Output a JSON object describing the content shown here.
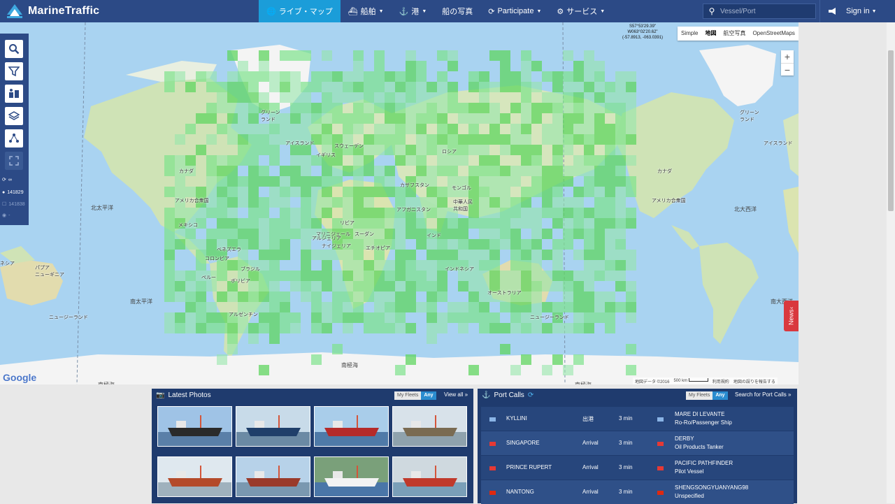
{
  "nav": {
    "brand": "MarineTraffic",
    "menu": [
      {
        "label": "ライブ・マップ",
        "icon": "globe-icon",
        "active": true
      },
      {
        "label": "船舶",
        "icon": "ship-icon",
        "caret": true
      },
      {
        "label": "港",
        "icon": "anchor-icon",
        "caret": true
      },
      {
        "label": "船の写真"
      },
      {
        "label": "Participate",
        "icon": "refresh-icon",
        "caret": true
      },
      {
        "label": "サービス",
        "icon": "gear-icon",
        "caret": true
      }
    ],
    "search_placeholder": "Vessel/Port",
    "signin": "Sign in"
  },
  "map": {
    "coords": [
      "S57°53'29.39\"",
      "W063°02'20.62\"",
      "(-57.8913, -063.0391)"
    ],
    "maptypes": [
      "Simple",
      "地図",
      "航空写真",
      "OpenStreetMaps"
    ],
    "maptype_selected": "地図",
    "zoom_in": "+",
    "zoom_out": "−",
    "google": "Google",
    "attribution": [
      "地図データ ©2016",
      "500 km",
      "利用規約",
      "地図の誤りを報告する"
    ],
    "labels": [
      {
        "t": "グリーン\nランド",
        "k": "greenland"
      },
      {
        "t": "アイスランド",
        "k": "iceland"
      },
      {
        "t": "スウェーデン",
        "k": "sweden"
      },
      {
        "t": "ロシア",
        "k": "russia"
      },
      {
        "t": "カナダ",
        "k": "canada"
      },
      {
        "t": "カザフスタン",
        "k": "kazakhstan"
      },
      {
        "t": "モンゴル",
        "k": "mongolia"
      },
      {
        "t": "中華人民\n共和国",
        "k": "china"
      },
      {
        "t": "アメリカ合衆国",
        "k": "usa"
      },
      {
        "t": "アフガニスタン",
        "k": "afghanistan"
      },
      {
        "t": "リビア",
        "k": "libya"
      },
      {
        "t": "アルジェリア",
        "k": "algeria"
      },
      {
        "t": "マリニジェール",
        "k": "mali"
      },
      {
        "t": "スーダン",
        "k": "sudan"
      },
      {
        "t": "インド",
        "k": "india"
      },
      {
        "t": "ナイジェリア",
        "k": "nigeria"
      },
      {
        "t": "エチオピア",
        "k": "ethiopia"
      },
      {
        "t": "ブラジル",
        "k": "brazil"
      },
      {
        "t": "オーストラリア",
        "k": "australia"
      },
      {
        "t": "ボリビア",
        "k": "bolivia"
      },
      {
        "t": "アルゼンチン",
        "k": "argentina"
      },
      {
        "t": "インドネシア",
        "k": "indonesia"
      },
      {
        "t": "メキシコ",
        "k": "mexico"
      },
      {
        "t": "ベネズエラ",
        "k": "venezuela"
      },
      {
        "t": "コロンビア",
        "k": "colombia"
      },
      {
        "t": "ペルー",
        "k": "peru"
      },
      {
        "t": "ニュージーランド",
        "k": "nz"
      },
      {
        "t": "パプア\nニューギニア",
        "k": "png"
      },
      {
        "t": "イギリス",
        "k": "uk"
      },
      {
        "t": "ネシア",
        "k": "nesia"
      },
      {
        "t": "ニュージーランド",
        "k": "nz2"
      },
      {
        "t": "アメリカ合衆国",
        "k": "usa2"
      },
      {
        "t": "カナダ",
        "k": "canada2"
      },
      {
        "t": "グリーン\nランド",
        "k": "greenland2"
      },
      {
        "t": "アイスランド",
        "k": "iceland2"
      }
    ],
    "oceans": [
      {
        "t": "北太平洋",
        "k": "npac"
      },
      {
        "t": "北大西洋",
        "k": "natl"
      },
      {
        "t": "南太平洋",
        "k": "spac"
      },
      {
        "t": "南大西洋",
        "k": "satl"
      },
      {
        "t": "南極海",
        "k": "so1"
      },
      {
        "t": "南極海",
        "k": "so2"
      },
      {
        "t": "南極海",
        "k": "so3"
      }
    ]
  },
  "toolbar": {
    "tools": [
      "search-icon",
      "filter-icon",
      "fleet-icon",
      "layers-icon",
      "network-icon",
      "fullscreen-icon"
    ],
    "infinity": "∞",
    "count1": "141829",
    "count2": "141838",
    "dash": "-"
  },
  "news": "News",
  "photos": {
    "title": "Latest Photos",
    "toggle": [
      "My Fleets",
      "Any"
    ],
    "toggle_selected": "Any",
    "view_all": "View all »",
    "items": [
      {
        "sky": "#9fc3e6",
        "sea": "#5a7fa8",
        "hull": "#2a2a2a"
      },
      {
        "sky": "#c8dbe9",
        "sea": "#6b8aa4",
        "hull": "#1f3f6a"
      },
      {
        "sky": "#a9cdea",
        "sea": "#4f7aa8",
        "hull": "#b52a2a"
      },
      {
        "sky": "#d8e2ea",
        "sea": "#8fa2ad",
        "hull": "#7a6b52"
      },
      {
        "sky": "#dfe8ef",
        "sea": "#9fb1bd",
        "hull": "#b44a2a"
      },
      {
        "sky": "#b7d2e9",
        "sea": "#7a98b0",
        "hull": "#9a3a2a"
      },
      {
        "sky": "#7aa07a",
        "sea": "#4a76a8",
        "hull": "#f2f2f2"
      },
      {
        "sky": "#cfd9df",
        "sea": "#7a9fb8",
        "hull": "#c0392b"
      }
    ]
  },
  "ports": {
    "title": "Port Calls",
    "toggle": [
      "My Fleets",
      "Any"
    ],
    "toggle_selected": "Any",
    "search_link": "Search for Port Calls »",
    "rows": [
      {
        "port": "KYLLINI",
        "event": "出港",
        "time": "3 min",
        "vessel": "MARE DI LEVANTE",
        "type": "Ro-Ro/Passenger Ship",
        "port_flag": "#8ab4e6",
        "vessel_flag": "#8ab4e6"
      },
      {
        "port": "SINGAPORE",
        "event": "Arrival",
        "time": "3 min",
        "vessel": "DERBY",
        "type": "Oil Products Tanker",
        "port_flag": "#e53935",
        "vessel_flag": "#e53935"
      },
      {
        "port": "PRINCE RUPERT",
        "event": "Arrival",
        "time": "3 min",
        "vessel": "PACIFIC PATHFINDER",
        "type": "Pilot Vessel",
        "port_flag": "#e53935",
        "vessel_flag": "#e53935"
      },
      {
        "port": "NANTONG",
        "event": "Arrival",
        "time": "3 min",
        "vessel": "SHENGSONGYUANYANG98",
        "type": "Unspecified",
        "port_flag": "#de2910",
        "vessel_flag": "#de2910"
      }
    ]
  }
}
